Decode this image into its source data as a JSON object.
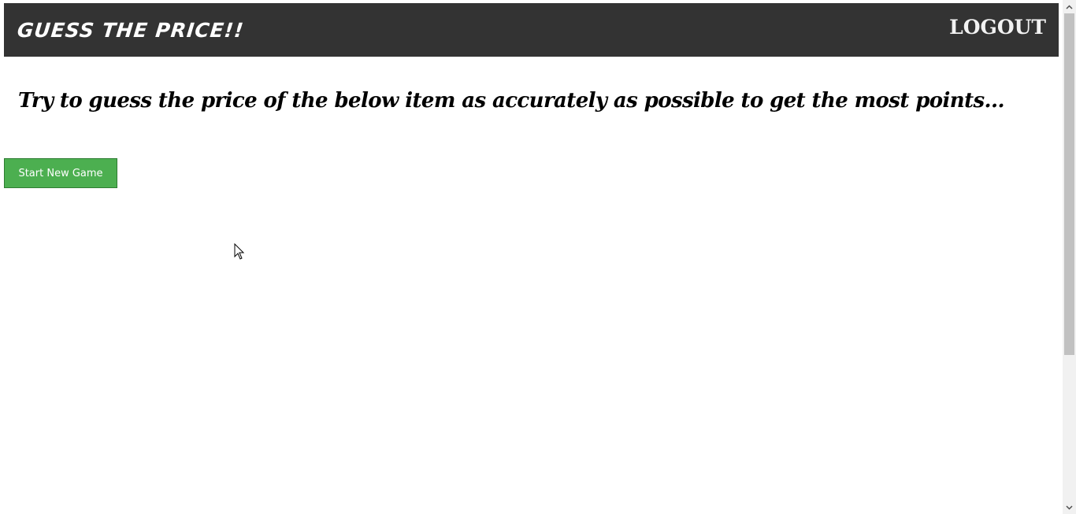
{
  "header": {
    "brand": "GUESS THE PRICE!!",
    "logout_label": "LOGOUT"
  },
  "main": {
    "instructions": "Try to guess the price of the below item as accurately as possible to get the most points...",
    "start_button_label": "Start New Game"
  },
  "colors": {
    "navbar_bg": "#333333",
    "button_bg": "#4caf50",
    "button_text": "#ffffff"
  },
  "icons": {
    "mouse_cursor": "mouse-cursor-icon",
    "scroll_up": "chevron-up-icon",
    "scroll_down": "chevron-down-icon"
  }
}
